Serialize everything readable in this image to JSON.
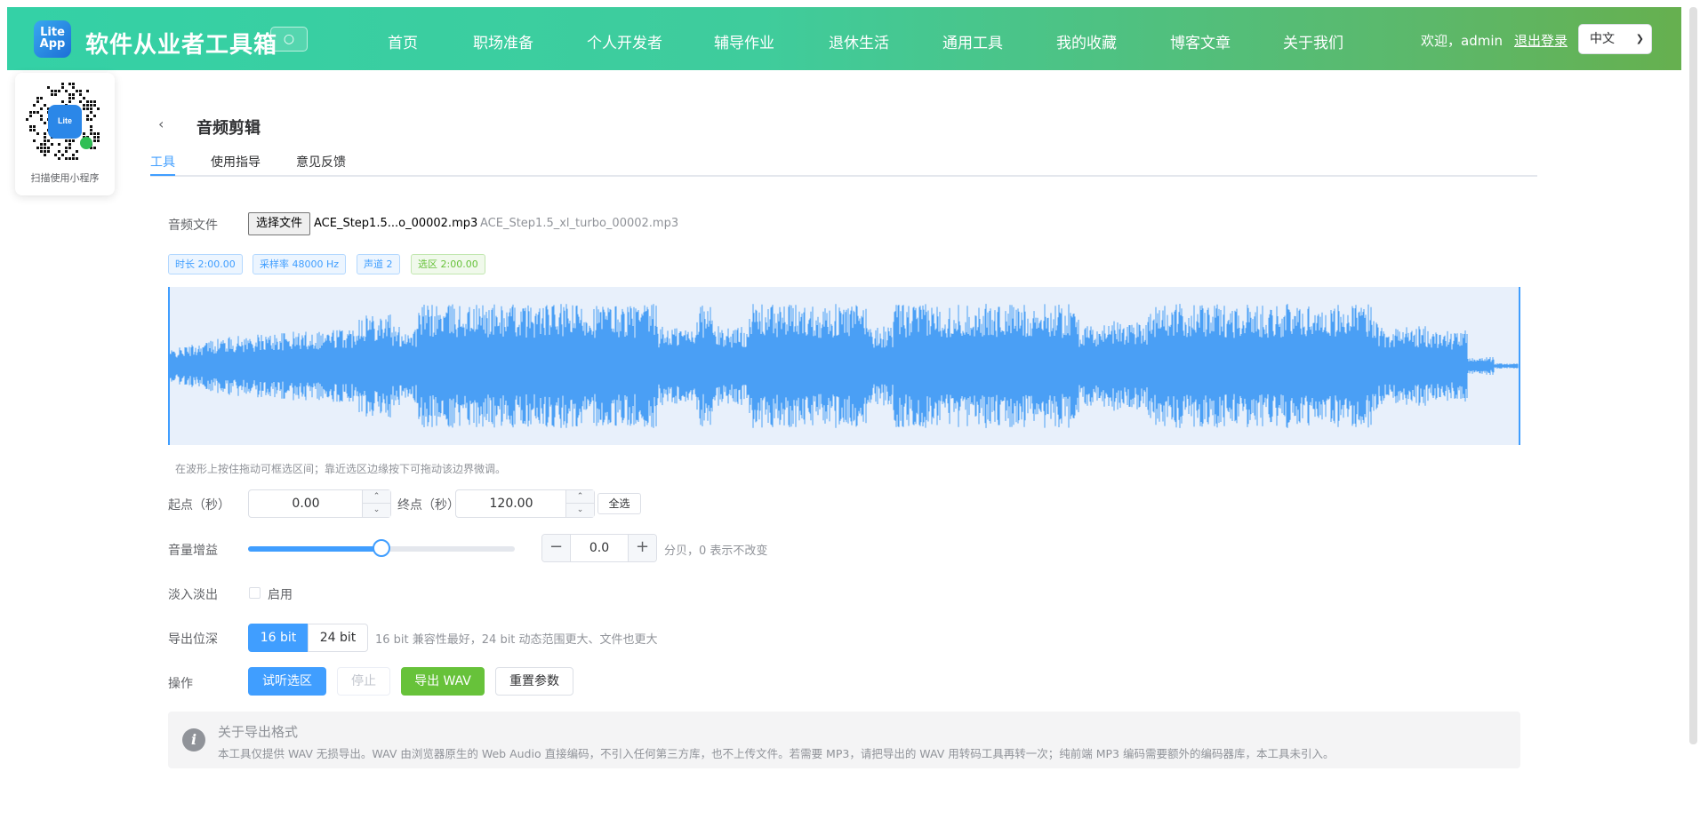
{
  "header": {
    "logo_text": "Lite App",
    "site_title": "软件从业者工具箱",
    "nav": [
      "首页",
      "职场准备",
      "个人开发者",
      "辅导作业",
      "退休生活",
      "通用工具",
      "我的收藏",
      "博客文章",
      "关于我们"
    ],
    "welcome": "欢迎，admin",
    "logout": "退出登录",
    "language": "中文"
  },
  "qr": {
    "label": "扫描使用小程序"
  },
  "page": {
    "title": "音频剪辑",
    "tabs": [
      "工具",
      "使用指导",
      "意见反馈"
    ],
    "active_tab": 0
  },
  "form": {
    "file_label": "音频文件",
    "file_button": "选择文件",
    "file_name_short": "ACE_Step1.5...o_00002.mp3",
    "file_name_full": "ACE_Step1.5_xl_turbo_00002.mp3",
    "tags": [
      "时长 2:00.00",
      "采样率 48000 Hz",
      "声道 2",
      "选区 2:00.00"
    ],
    "hint": "在波形上按住拖动可框选区间；靠近选区边缘按下可拖动该边界微调。",
    "start_label": "起点（秒）",
    "start_value": "0.00",
    "end_label": "终点（秒）",
    "end_value": "120.00",
    "select_all": "全选",
    "gain_label": "音量增益",
    "gain_slider_fraction": 0.5,
    "gain_value": "0.0",
    "gain_note": "分贝，0 表示不改变",
    "fade_label": "淡入淡出",
    "fade_checkbox": "启用",
    "depth_label": "导出位深",
    "depth_options": [
      "16 bit",
      "24 bit"
    ],
    "depth_note": "16 bit 兼容性最好，24 bit 动态范围更大、文件也更大",
    "action_label": "操作",
    "actions": [
      "试听选区",
      "停止",
      "导出 WAV",
      "重置参数"
    ]
  },
  "info": {
    "icon": "info-icon",
    "title": "关于导出格式",
    "desc": "本工具仅提供 WAV 无损导出。WAV 由浏览器原生的 Web Audio 直接编码，不引入任何第三方库，也不上传文件。若需要 MP3，请把导出的 WAV 用转码工具再转一次；纯前端 MP3 编码需要额外的编码器库，本工具未引入。"
  },
  "colors": {
    "primary": "#409eff",
    "success": "#67c23a",
    "wave": "#4a9ff5"
  }
}
